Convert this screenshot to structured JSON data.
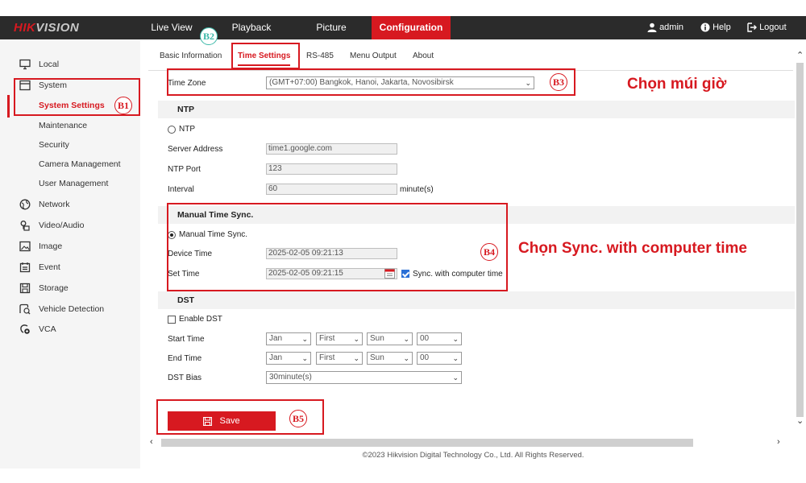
{
  "brand": {
    "logo_left": "HIK",
    "logo_right": "VISION"
  },
  "topnav": {
    "items": [
      {
        "label": "Live View"
      },
      {
        "label": "Playback"
      },
      {
        "label": "Picture"
      },
      {
        "label": "Configuration"
      }
    ],
    "user": "admin",
    "help": "Help",
    "logout": "Logout"
  },
  "sidebar": {
    "items": [
      {
        "label": "Local",
        "icon": "monitor-icon"
      },
      {
        "label": "System",
        "icon": "system-icon"
      },
      {
        "label": "System Settings"
      },
      {
        "label": "Maintenance"
      },
      {
        "label": "Security"
      },
      {
        "label": "Camera Management"
      },
      {
        "label": "User Management"
      },
      {
        "label": "Network",
        "icon": "globe-icon"
      },
      {
        "label": "Video/Audio",
        "icon": "video-audio-icon"
      },
      {
        "label": "Image",
        "icon": "image-icon"
      },
      {
        "label": "Event",
        "icon": "event-icon"
      },
      {
        "label": "Storage",
        "icon": "storage-icon"
      },
      {
        "label": "Vehicle Detection",
        "icon": "vehicle-detection-icon"
      },
      {
        "label": "VCA",
        "icon": "vca-icon"
      }
    ]
  },
  "tabs": [
    {
      "label": "Basic Information"
    },
    {
      "label": "Time Settings"
    },
    {
      "label": "RS-485"
    },
    {
      "label": "Menu Output"
    },
    {
      "label": "About"
    }
  ],
  "form": {
    "time_zone_label": "Time Zone",
    "time_zone_value": "(GMT+07:00) Bangkok, Hanoi, Jakarta, Novosibirsk",
    "ntp_section": "NTP",
    "ntp_radio": "NTP",
    "server_address_label": "Server Address",
    "server_address_value": "time1.google.com",
    "ntp_port_label": "NTP Port",
    "ntp_port_value": "123",
    "interval_label": "Interval",
    "interval_value": "60",
    "interval_unit": "minute(s)",
    "manual_section": "Manual Time Sync.",
    "manual_radio": "Manual Time Sync.",
    "device_time_label": "Device Time",
    "device_time_value": "2025-02-05 09:21:13",
    "set_time_label": "Set Time",
    "set_time_value": "2025-02-05 09:21:15",
    "sync_label": "Sync. with computer time",
    "dst_section": "DST",
    "enable_dst": "Enable DST",
    "start_time_label": "Start Time",
    "end_time_label": "End Time",
    "start": {
      "month": "Jan",
      "week": "First",
      "day": "Sun",
      "hour": "00"
    },
    "end": {
      "month": "Jan",
      "week": "First",
      "day": "Sun",
      "hour": "00"
    },
    "dst_bias_label": "DST Bias",
    "dst_bias_value": "30minute(s)",
    "save": "Save"
  },
  "annotations": {
    "b1": "B1",
    "b2": "B2",
    "b3": "B3",
    "b4": "B4",
    "b5": "B5",
    "choose_timezone": "Chọn múi giờ",
    "choose_sync": "Chọn Sync. with computer time"
  },
  "footer": "©2023 Hikvision Digital Technology Co., Ltd. All Rights Reserved.",
  "colors": {
    "accent": "#d71920",
    "topbar": "#2b2b2b",
    "sidebar": "#f5f5f5",
    "teal": "#3bb8a8"
  }
}
